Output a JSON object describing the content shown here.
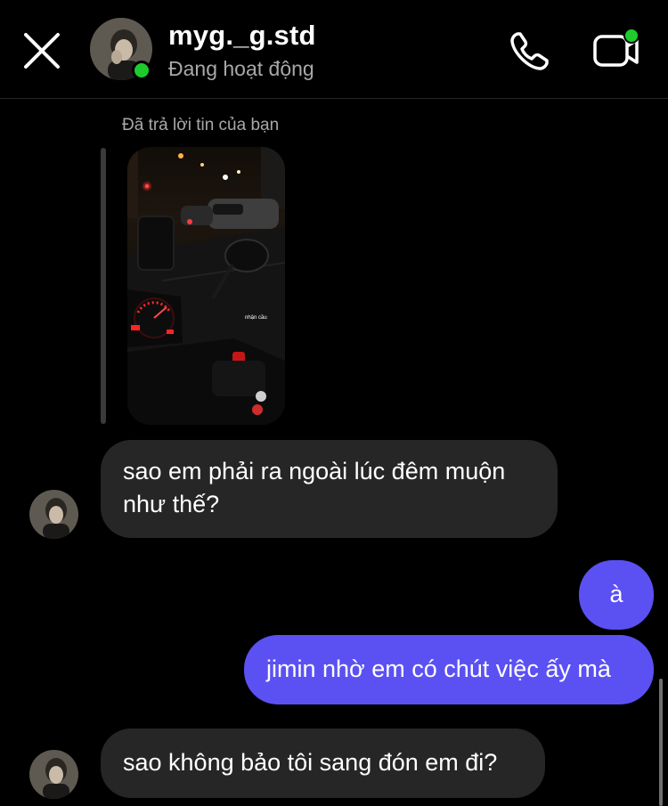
{
  "header": {
    "username": "myg._g.std",
    "status": "Đang hoạt động",
    "colors": {
      "online": "#1fca2c"
    }
  },
  "thread": {
    "reply_context": "Đã trả lời tin của bạn",
    "story_caption": "nhận cầu"
  },
  "messages": [
    {
      "from": "them",
      "text": "sao em phải ra ngoài lúc đêm muộn như thế?"
    },
    {
      "from": "me",
      "text": "à"
    },
    {
      "from": "me",
      "text": "jimin nhờ em có chút việc ấy mà"
    },
    {
      "from": "them",
      "text": "sao không bảo tôi sang đón em đi?"
    }
  ],
  "icons": {
    "close": "close-icon",
    "call": "phone-icon",
    "video": "video-camera-icon"
  },
  "colors": {
    "background": "#000000",
    "incoming_bubble": "#262626",
    "outgoing_bubble": "#5b51f2",
    "secondary_text": "#a8a8a8"
  }
}
